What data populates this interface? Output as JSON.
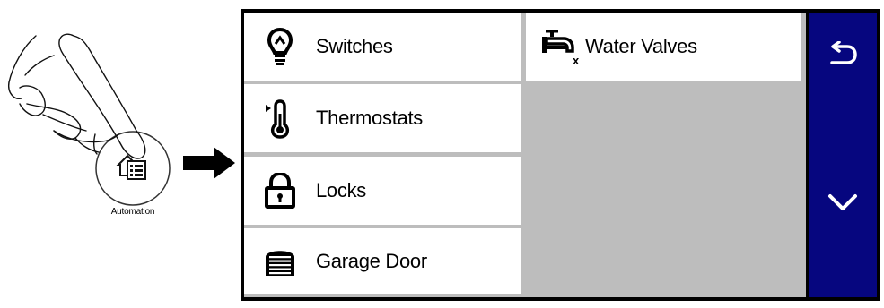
{
  "illustration": {
    "app_label": "Automation"
  },
  "menu": {
    "items": [
      {
        "label": "Switches",
        "icon": "lightbulb-icon"
      },
      {
        "label": "Thermostats",
        "icon": "thermometer-icon"
      },
      {
        "label": "Locks",
        "icon": "padlock-icon"
      },
      {
        "label": "Garage Door",
        "icon": "garage-door-icon"
      },
      {
        "label": "Water Valves",
        "icon": "water-valve-icon"
      }
    ]
  },
  "sidebar": {
    "back_icon": "back-arrow-icon",
    "down_icon": "chevron-down-icon"
  },
  "colors": {
    "sidebar_bg": "#06067f",
    "menu_bg": "#bdbdbd",
    "tile_bg": "#ffffff"
  }
}
